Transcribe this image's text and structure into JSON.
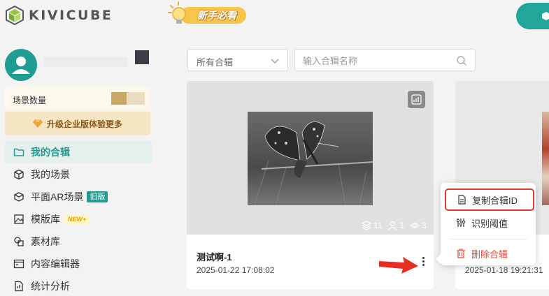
{
  "header": {
    "brand": "KIVICUBE",
    "newbie_label": "新手必看"
  },
  "sidebar": {
    "scene_label": "场景数量",
    "scene_usage_fraction": 0.45,
    "upgrade_label": "升级企业版体验更多",
    "items": [
      {
        "label": "我的合辑",
        "icon": "folder-icon",
        "active": true
      },
      {
        "label": "我的场景",
        "icon": "cube-icon"
      },
      {
        "label": "平面AR场景",
        "icon": "ar-plane-icon",
        "tag": "旧版"
      },
      {
        "label": "模版库",
        "icon": "template-icon",
        "tag_new": "NEW+"
      },
      {
        "label": "素材库",
        "icon": "material-icon"
      },
      {
        "label": "内容编辑器",
        "icon": "editor-icon"
      },
      {
        "label": "统计分析",
        "icon": "stats-icon"
      }
    ]
  },
  "filters": {
    "select_value": "所有合辑",
    "search_placeholder": "输入合辑名称"
  },
  "cards": [
    {
      "title": "测试啊-1",
      "date": "2025-01-22 17:08:02",
      "scenes": "11",
      "users": "1",
      "views": "3"
    },
    {
      "date": "2025-01-18 19:21:31"
    }
  ],
  "menu": {
    "copy_id": "复制合辑ID",
    "threshold": "识别阈值",
    "delete": "删除合辑"
  },
  "colors": {
    "accent": "#1f9d93",
    "danger": "#e0473d",
    "highlight": "#e23b2f"
  }
}
